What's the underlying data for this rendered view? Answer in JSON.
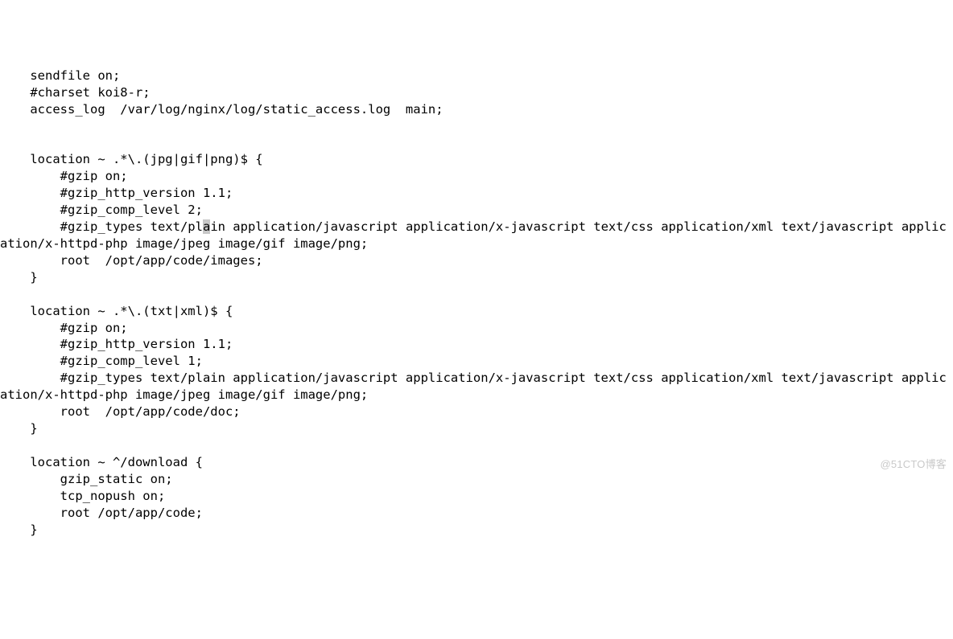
{
  "code": {
    "lines": [
      "    sendfile on;",
      "    #charset koi8-r;",
      "    access_log  /var/log/nginx/log/static_access.log  main;",
      "",
      "",
      "    location ~ .*\\.(jpg|gif|png)$ {",
      "        #gzip on;",
      "        #gzip_http_version 1.1;",
      "        #gzip_comp_level 2;",
      {
        "pre": "        #gzip_types text/pl",
        "hl": "a",
        "post": "in application/javascript application/x-javascript text/css application/xml text/javascript application/x-httpd-php image/jpeg image/gif image/png;"
      },
      "        root  /opt/app/code/images;",
      "    }",
      "",
      "    location ~ .*\\.(txt|xml)$ {",
      "        #gzip on;",
      "        #gzip_http_version 1.1;",
      "        #gzip_comp_level 1;",
      "        #gzip_types text/plain application/javascript application/x-javascript text/css application/xml text/javascript application/x-httpd-php image/jpeg image/gif image/png;",
      "        root  /opt/app/code/doc;",
      "    }",
      "",
      "    location ~ ^/download {",
      "        gzip_static on;",
      "        tcp_nopush on;",
      "        root /opt/app/code;",
      "    }"
    ]
  },
  "watermark": "@51CTO博客"
}
